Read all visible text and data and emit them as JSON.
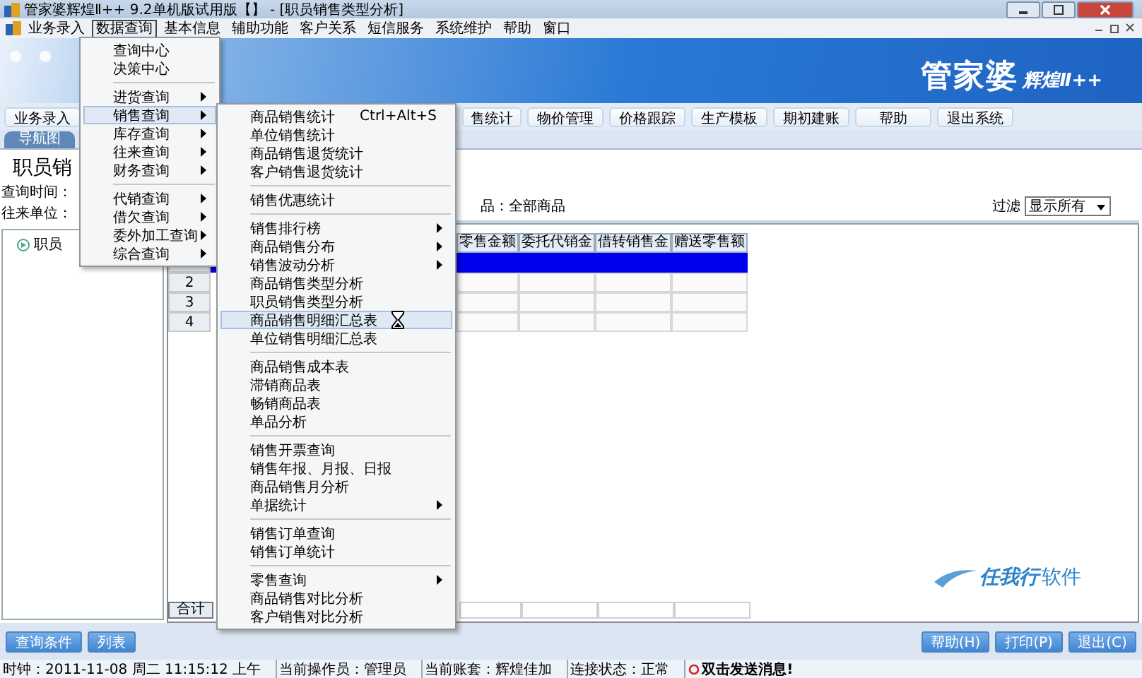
{
  "window": {
    "title": "管家婆辉煌Ⅱ++ 9.2单机版试用版【】 - [职员销售类型分析]"
  },
  "menubar": [
    {
      "label": "业务录入",
      "selected": false
    },
    {
      "label": "数据查询",
      "selected": true
    },
    {
      "label": "基本信息",
      "selected": false
    },
    {
      "label": "辅助功能",
      "selected": false
    },
    {
      "label": "客户关系",
      "selected": false
    },
    {
      "label": "短信服务",
      "selected": false
    },
    {
      "label": "系统维护",
      "selected": false
    },
    {
      "label": "帮助",
      "selected": false
    },
    {
      "label": "窗口",
      "selected": false
    }
  ],
  "banner": {
    "logo": "管家婆",
    "logo_suffix": "辉煌Ⅱ++"
  },
  "toolbar": [
    "业务录入",
    "售统计",
    "物价管理",
    "价格跟踪",
    "生产模板",
    "期初建账",
    "帮助",
    "退出系统"
  ],
  "nav_tab": {
    "label": "导航图"
  },
  "report": {
    "title": "职员销",
    "query_time": "查询时间：",
    "partner": "往来单位：",
    "product": "品：全部商品",
    "filter_label": "过滤",
    "filter_value": "显示所有"
  },
  "tree": [
    {
      "label": "职员"
    }
  ],
  "table": {
    "columns": [
      "零售金额",
      "委托代销金",
      "借转销售金",
      "赠送零售额"
    ],
    "rows": [
      {
        "selected": true
      },
      {
        "number": "2",
        "selected": false
      },
      {
        "number": "3",
        "selected": false
      },
      {
        "number": "4",
        "selected": false
      }
    ],
    "total_label": "合计"
  },
  "brand": {
    "logo": "任我行",
    "suffix": "软件"
  },
  "left_buttons": [
    "查询条件",
    "列表"
  ],
  "right_buttons": [
    "帮助(H)",
    "打印(P)",
    "退出(C)"
  ],
  "status_bar": [
    "时钟：2011-11-08 周二 11:15:12 上午",
    "当前操作员：管理员",
    "当前账套：辉煌佳加",
    "连接状态：正常"
  ],
  "message": "双击发送消息!",
  "menu": [
    {
      "label": "查询中心",
      "submenu": false,
      "selected": false,
      "separator_before": false
    },
    {
      "label": "决策中心",
      "submenu": false,
      "selected": false,
      "separator_before": false
    },
    {
      "label": "进货查询",
      "submenu": true,
      "selected": false,
      "separator_before": true
    },
    {
      "label": "销售查询",
      "submenu": true,
      "selected": true,
      "separator_before": false
    },
    {
      "label": "库存查询",
      "submenu": true,
      "selected": false,
      "separator_before": false
    },
    {
      "label": "往来查询",
      "submenu": true,
      "selected": false,
      "separator_before": false
    },
    {
      "label": "财务查询",
      "submenu": true,
      "selected": false,
      "separator_before": false
    },
    {
      "label": "代销查询",
      "submenu": true,
      "selected": false,
      "separator_before": true
    },
    {
      "label": "借欠查询",
      "submenu": true,
      "selected": false,
      "separator_before": false
    },
    {
      "label": "委外加工查询",
      "submenu": true,
      "selected": false,
      "separator_before": false
    },
    {
      "label": "综合查询",
      "submenu": true,
      "selected": false,
      "separator_before": false
    }
  ],
  "submenu": [
    {
      "label": "商品销售统计",
      "shortcut": "Ctrl+Alt+S",
      "submenu": false,
      "selected": false,
      "separator_before": false
    },
    {
      "label": "单位销售统计",
      "submenu": false,
      "selected": false,
      "separator_before": false
    },
    {
      "label": "商品销售退货统计",
      "submenu": false,
      "selected": false,
      "separator_before": false
    },
    {
      "label": "客户销售退货统计",
      "submenu": false,
      "selected": false,
      "separator_before": false
    },
    {
      "label": "销售优惠统计",
      "submenu": false,
      "selected": false,
      "separator_before": true
    },
    {
      "label": "销售排行榜",
      "submenu": true,
      "selected": false,
      "separator_before": true
    },
    {
      "label": "商品销售分布",
      "submenu": true,
      "selected": false,
      "separator_before": false
    },
    {
      "label": "销售波动分析",
      "submenu": true,
      "selected": false,
      "separator_before": false
    },
    {
      "label": "商品销售类型分析",
      "submenu": false,
      "selected": false,
      "separator_before": false
    },
    {
      "label": "职员销售类型分析",
      "submenu": false,
      "selected": false,
      "separator_before": false
    },
    {
      "label": "商品销售明细汇总表",
      "submenu": false,
      "selected": true,
      "separator_before": false
    },
    {
      "label": "单位销售明细汇总表",
      "submenu": false,
      "selected": false,
      "separator_before": false
    },
    {
      "label": "商品销售成本表",
      "submenu": false,
      "selected": false,
      "separator_before": true
    },
    {
      "label": "滞销商品表",
      "submenu": false,
      "selected": false,
      "separator_before": false
    },
    {
      "label": "畅销商品表",
      "submenu": false,
      "selected": false,
      "separator_before": false
    },
    {
      "label": "单品分析",
      "submenu": false,
      "selected": false,
      "separator_before": false
    },
    {
      "label": "销售开票查询",
      "submenu": false,
      "selected": false,
      "separator_before": true
    },
    {
      "label": "销售年报、月报、日报",
      "submenu": false,
      "selected": false,
      "separator_before": false
    },
    {
      "label": "商品销售月分析",
      "submenu": false,
      "selected": false,
      "separator_before": false
    },
    {
      "label": "单据统计",
      "submenu": true,
      "selected": false,
      "separator_before": false
    },
    {
      "label": "销售订单查询",
      "submenu": false,
      "selected": false,
      "separator_before": true
    },
    {
      "label": "销售订单统计",
      "submenu": false,
      "selected": false,
      "separator_before": false
    },
    {
      "label": "零售查询",
      "submenu": true,
      "selected": false,
      "separator_before": true
    },
    {
      "label": "商品销售对比分析",
      "submenu": false,
      "selected": false,
      "separator_before": false
    },
    {
      "label": "客户销售对比分析",
      "submenu": false,
      "selected": false,
      "separator_before": false
    }
  ]
}
